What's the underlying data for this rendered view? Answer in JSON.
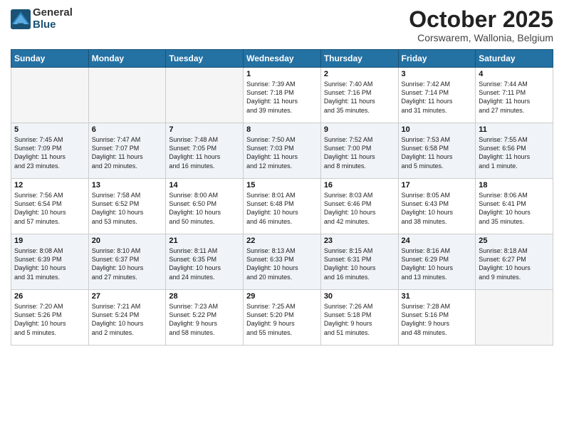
{
  "header": {
    "logo_general": "General",
    "logo_blue": "Blue",
    "month": "October 2025",
    "location": "Corswarem, Wallonia, Belgium"
  },
  "weekdays": [
    "Sunday",
    "Monday",
    "Tuesday",
    "Wednesday",
    "Thursday",
    "Friday",
    "Saturday"
  ],
  "weeks": [
    [
      {
        "day": "",
        "info": ""
      },
      {
        "day": "",
        "info": ""
      },
      {
        "day": "",
        "info": ""
      },
      {
        "day": "1",
        "info": "Sunrise: 7:39 AM\nSunset: 7:18 PM\nDaylight: 11 hours\nand 39 minutes."
      },
      {
        "day": "2",
        "info": "Sunrise: 7:40 AM\nSunset: 7:16 PM\nDaylight: 11 hours\nand 35 minutes."
      },
      {
        "day": "3",
        "info": "Sunrise: 7:42 AM\nSunset: 7:14 PM\nDaylight: 11 hours\nand 31 minutes."
      },
      {
        "day": "4",
        "info": "Sunrise: 7:44 AM\nSunset: 7:11 PM\nDaylight: 11 hours\nand 27 minutes."
      }
    ],
    [
      {
        "day": "5",
        "info": "Sunrise: 7:45 AM\nSunset: 7:09 PM\nDaylight: 11 hours\nand 23 minutes."
      },
      {
        "day": "6",
        "info": "Sunrise: 7:47 AM\nSunset: 7:07 PM\nDaylight: 11 hours\nand 20 minutes."
      },
      {
        "day": "7",
        "info": "Sunrise: 7:48 AM\nSunset: 7:05 PM\nDaylight: 11 hours\nand 16 minutes."
      },
      {
        "day": "8",
        "info": "Sunrise: 7:50 AM\nSunset: 7:03 PM\nDaylight: 11 hours\nand 12 minutes."
      },
      {
        "day": "9",
        "info": "Sunrise: 7:52 AM\nSunset: 7:00 PM\nDaylight: 11 hours\nand 8 minutes."
      },
      {
        "day": "10",
        "info": "Sunrise: 7:53 AM\nSunset: 6:58 PM\nDaylight: 11 hours\nand 5 minutes."
      },
      {
        "day": "11",
        "info": "Sunrise: 7:55 AM\nSunset: 6:56 PM\nDaylight: 11 hours\nand 1 minute."
      }
    ],
    [
      {
        "day": "12",
        "info": "Sunrise: 7:56 AM\nSunset: 6:54 PM\nDaylight: 10 hours\nand 57 minutes."
      },
      {
        "day": "13",
        "info": "Sunrise: 7:58 AM\nSunset: 6:52 PM\nDaylight: 10 hours\nand 53 minutes."
      },
      {
        "day": "14",
        "info": "Sunrise: 8:00 AM\nSunset: 6:50 PM\nDaylight: 10 hours\nand 50 minutes."
      },
      {
        "day": "15",
        "info": "Sunrise: 8:01 AM\nSunset: 6:48 PM\nDaylight: 10 hours\nand 46 minutes."
      },
      {
        "day": "16",
        "info": "Sunrise: 8:03 AM\nSunset: 6:46 PM\nDaylight: 10 hours\nand 42 minutes."
      },
      {
        "day": "17",
        "info": "Sunrise: 8:05 AM\nSunset: 6:43 PM\nDaylight: 10 hours\nand 38 minutes."
      },
      {
        "day": "18",
        "info": "Sunrise: 8:06 AM\nSunset: 6:41 PM\nDaylight: 10 hours\nand 35 minutes."
      }
    ],
    [
      {
        "day": "19",
        "info": "Sunrise: 8:08 AM\nSunset: 6:39 PM\nDaylight: 10 hours\nand 31 minutes."
      },
      {
        "day": "20",
        "info": "Sunrise: 8:10 AM\nSunset: 6:37 PM\nDaylight: 10 hours\nand 27 minutes."
      },
      {
        "day": "21",
        "info": "Sunrise: 8:11 AM\nSunset: 6:35 PM\nDaylight: 10 hours\nand 24 minutes."
      },
      {
        "day": "22",
        "info": "Sunrise: 8:13 AM\nSunset: 6:33 PM\nDaylight: 10 hours\nand 20 minutes."
      },
      {
        "day": "23",
        "info": "Sunrise: 8:15 AM\nSunset: 6:31 PM\nDaylight: 10 hours\nand 16 minutes."
      },
      {
        "day": "24",
        "info": "Sunrise: 8:16 AM\nSunset: 6:29 PM\nDaylight: 10 hours\nand 13 minutes."
      },
      {
        "day": "25",
        "info": "Sunrise: 8:18 AM\nSunset: 6:27 PM\nDaylight: 10 hours\nand 9 minutes."
      }
    ],
    [
      {
        "day": "26",
        "info": "Sunrise: 7:20 AM\nSunset: 5:26 PM\nDaylight: 10 hours\nand 5 minutes."
      },
      {
        "day": "27",
        "info": "Sunrise: 7:21 AM\nSunset: 5:24 PM\nDaylight: 10 hours\nand 2 minutes."
      },
      {
        "day": "28",
        "info": "Sunrise: 7:23 AM\nSunset: 5:22 PM\nDaylight: 9 hours\nand 58 minutes."
      },
      {
        "day": "29",
        "info": "Sunrise: 7:25 AM\nSunset: 5:20 PM\nDaylight: 9 hours\nand 55 minutes."
      },
      {
        "day": "30",
        "info": "Sunrise: 7:26 AM\nSunset: 5:18 PM\nDaylight: 9 hours\nand 51 minutes."
      },
      {
        "day": "31",
        "info": "Sunrise: 7:28 AM\nSunset: 5:16 PM\nDaylight: 9 hours\nand 48 minutes."
      },
      {
        "day": "",
        "info": ""
      }
    ]
  ]
}
